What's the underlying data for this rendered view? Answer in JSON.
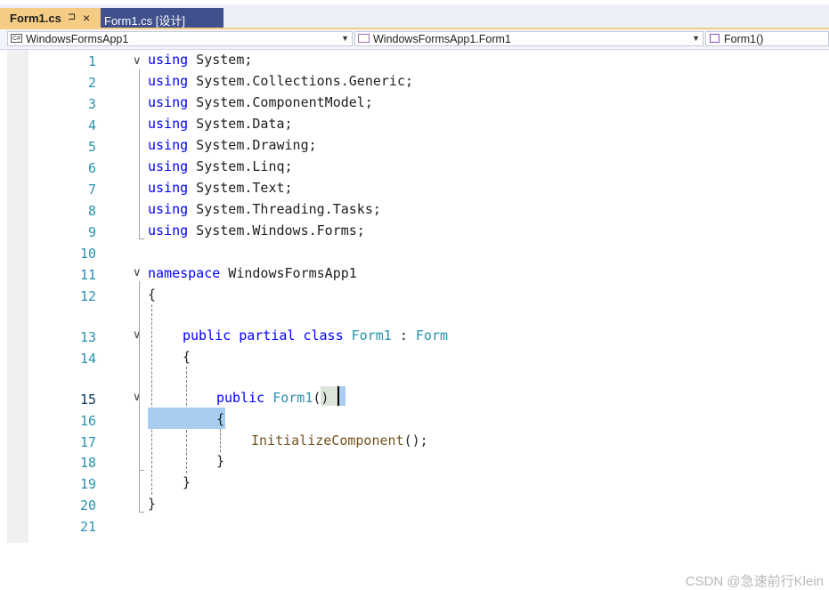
{
  "tabs": [
    {
      "label": "Form1.cs",
      "pin": "⊐",
      "close": "×",
      "active": true
    },
    {
      "label": "Form1.cs [设计]",
      "active": false
    }
  ],
  "navbar": {
    "project": "WindowsFormsApp1",
    "class": "WindowsFormsApp1.Form1",
    "member": "Form1()"
  },
  "editor": {
    "line_numbers": [
      "1",
      "2",
      "3",
      "4",
      "5",
      "6",
      "7",
      "8",
      "9",
      "10",
      "11",
      "12",
      "13",
      "14",
      "15",
      "16",
      "17",
      "18",
      "19",
      "20",
      "21"
    ],
    "lines": [
      {
        "kw": "using",
        "rest": " System;"
      },
      {
        "kw": "using",
        "rest": " System.Collections.Generic;"
      },
      {
        "kw": "using",
        "rest": " System.ComponentModel;"
      },
      {
        "kw": "using",
        "rest": " System.Data;"
      },
      {
        "kw": "using",
        "rest": " System.Drawing;"
      },
      {
        "kw": "using",
        "rest": " System.Linq;"
      },
      {
        "kw": "using",
        "rest": " System.Text;"
      },
      {
        "kw": "using",
        "rest": " System.Threading.Tasks;"
      },
      {
        "kw": "using",
        "rest": " System.Windows.Forms;"
      },
      {
        "kw": "namespace",
        "rest": " WindowsFormsApp1"
      },
      {
        "text": "{"
      },
      {
        "kw": "public partial class",
        "type": "Form1",
        "sep": " : ",
        "type2": "Form"
      },
      {
        "text": "{"
      },
      {
        "kw": "public",
        "type": "Form1",
        "paren": "()"
      },
      {
        "text": "{"
      },
      {
        "method": "InitializeComponent",
        "rest": "();"
      },
      {
        "text": "}"
      },
      {
        "text": "}"
      },
      {
        "text": "}"
      }
    ]
  },
  "watermark": "CSDN @急速前行Klein",
  "colors": {
    "keyword": "#0000ff",
    "type": "#2b91af",
    "method": "#74531f",
    "line_number": "#2b91af",
    "active_tab": "#f5cc84",
    "inactive_tab": "#40508d",
    "selection": "#a6cdf0"
  }
}
